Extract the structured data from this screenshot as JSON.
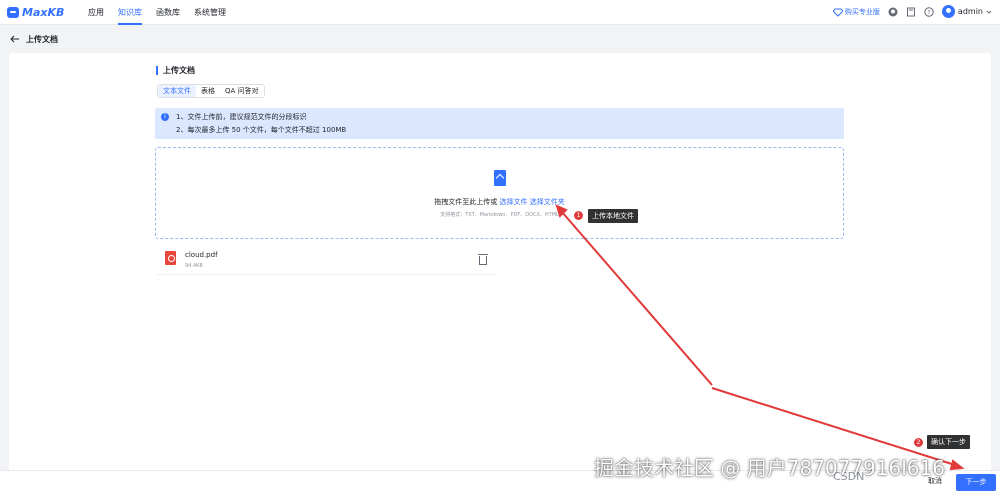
{
  "app": {
    "logo_text": "MaxKB",
    "brand_color": "#3370ff"
  },
  "nav": {
    "items": [
      "应用",
      "知识库",
      "函数库",
      "系统管理"
    ],
    "active_index": 1
  },
  "header_right": {
    "upgrade_label": "购买专业版",
    "icons": [
      "github-icon",
      "book-icon",
      "help-icon"
    ],
    "user": "admin"
  },
  "subheader": {
    "back_icon": "arrow-left-icon",
    "title": "上传文档"
  },
  "section": {
    "title": "上传文档"
  },
  "tabs": [
    "文本文件",
    "表格",
    "QA 问答对"
  ],
  "notice": {
    "line1": "1、文件上传前，建议规范文件的分段标识",
    "line2": "2、每次最多上传 50 个文件，每个文件不超过 100MB"
  },
  "dropzone": {
    "text_prefix": "拖拽文件至此上传或",
    "link1": "选择文件",
    "link2": "选择文件夹",
    "hint": "支持格式：TXT、Markdown、PDF、DOCX、HTML"
  },
  "files": [
    {
      "name": "cloud.pdf",
      "size": "94.4KB"
    }
  ],
  "annotations": {
    "a1": {
      "num": "1",
      "label": "上传本地文件"
    },
    "a2": {
      "num": "2",
      "label": "确认下一步"
    },
    "arrow_color": "#e03a3a"
  },
  "footer": {
    "cancel": "取消",
    "next": "下一步"
  },
  "watermark": {
    "text": "掘金技术社区 @ 用户787077916l616",
    "csdn": "CSDN"
  }
}
